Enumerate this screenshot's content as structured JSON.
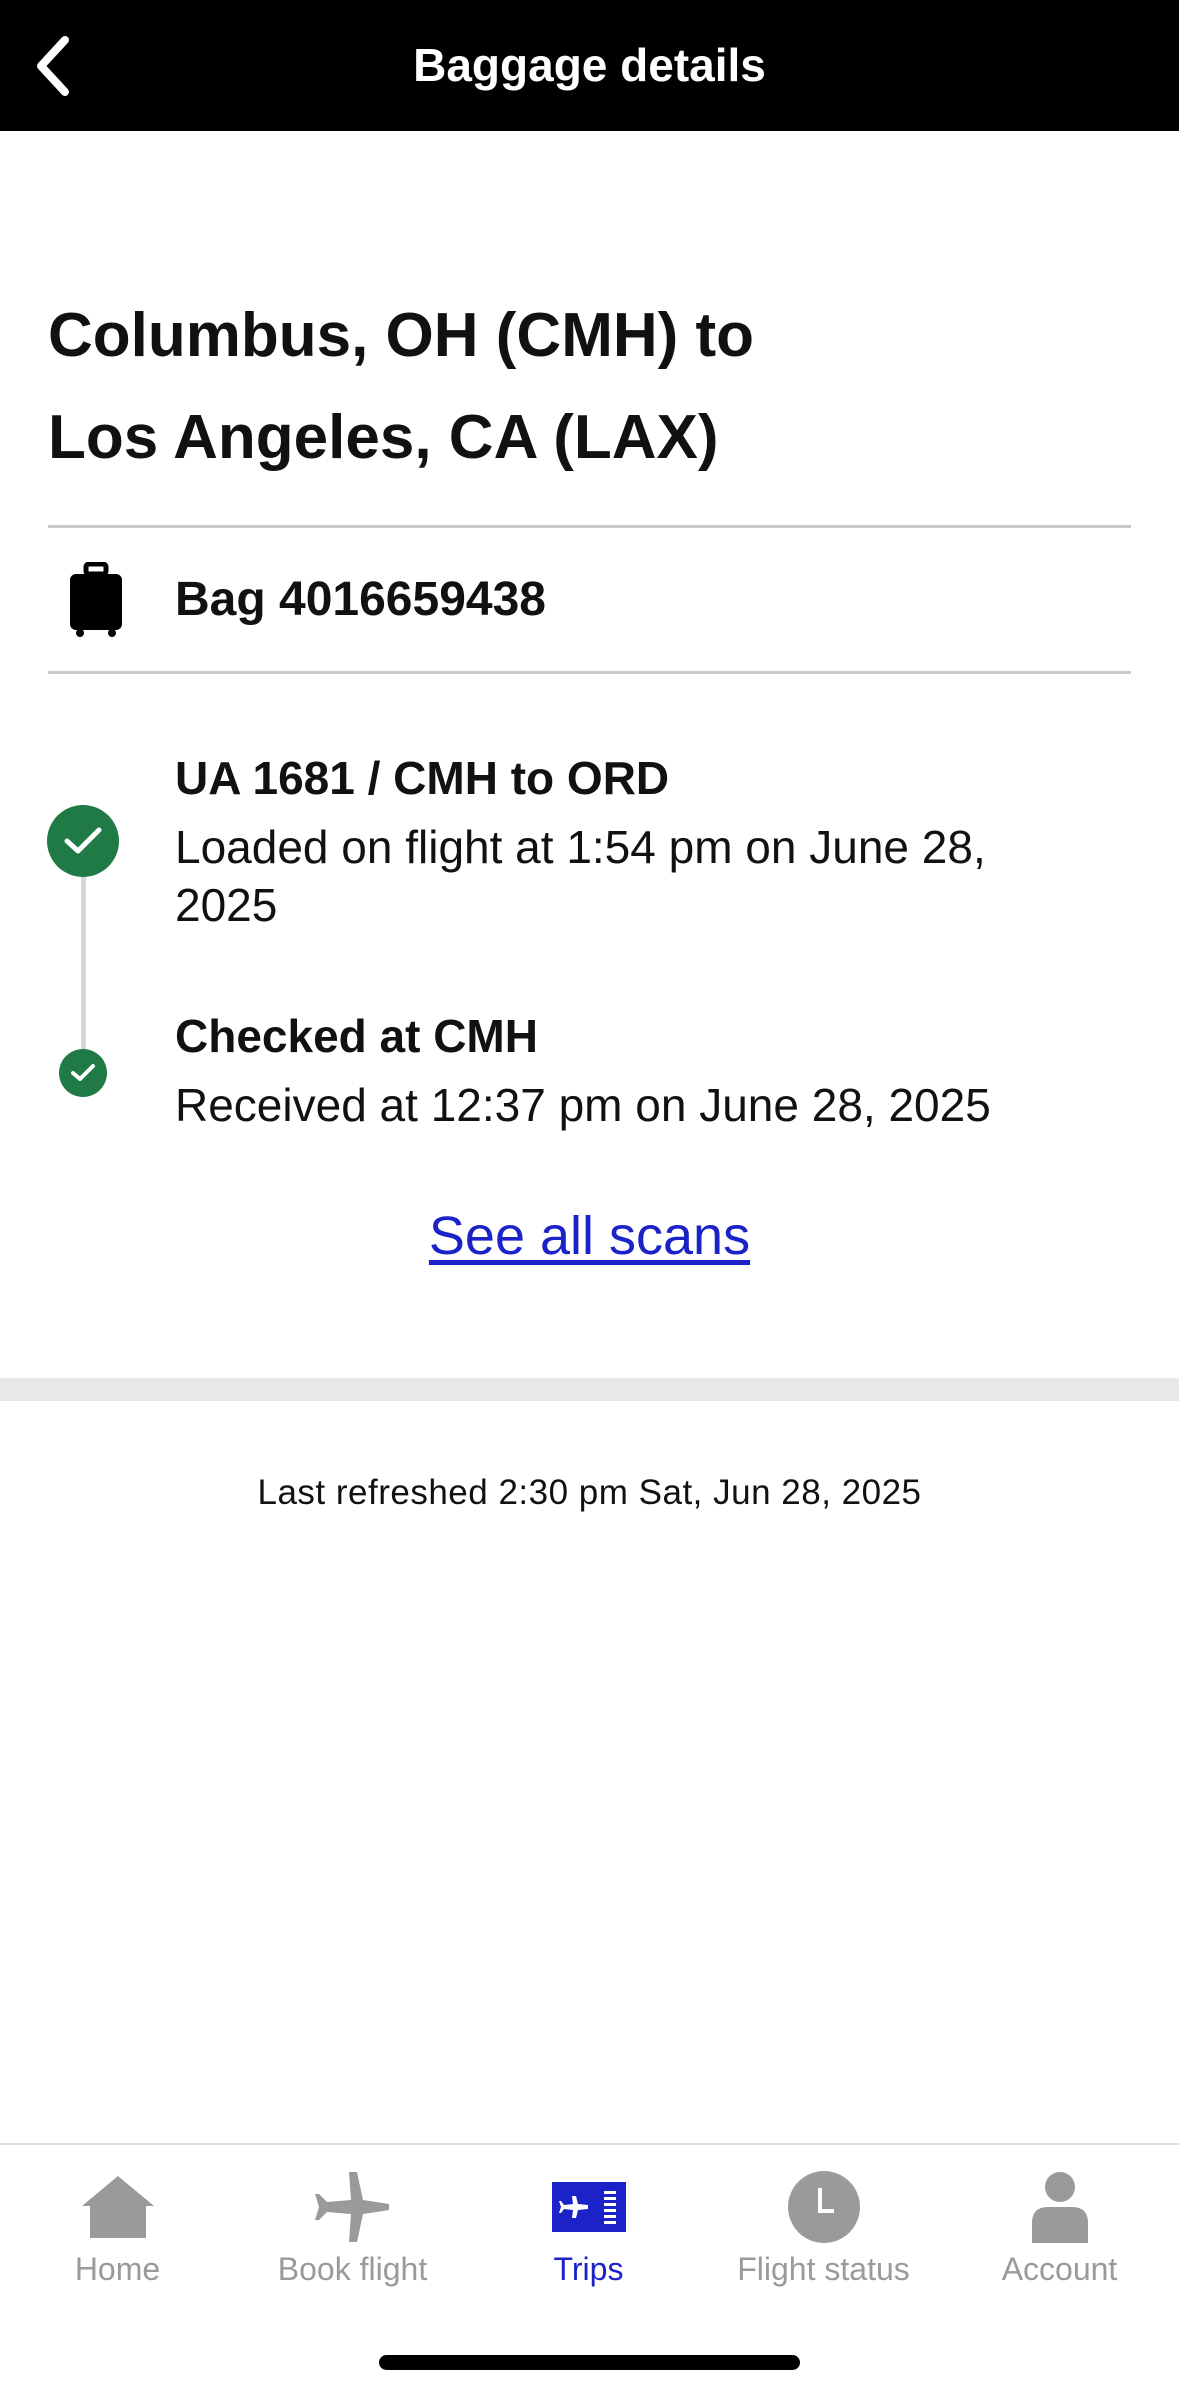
{
  "header": {
    "title": "Baggage details",
    "back_icon": "chevron-left-icon"
  },
  "route": {
    "line1": "Columbus, OH (CMH) to",
    "line2": "Los Angeles, CA (LAX)"
  },
  "bag": {
    "icon": "suitcase-icon",
    "label": "Bag 4016659438"
  },
  "timeline": [
    {
      "title": "UA 1681 / CMH to ORD",
      "detail": "Loaded on flight at 1:54 pm on June 28, 2025",
      "status": "complete"
    },
    {
      "title": "Checked at CMH",
      "detail": "Received at 12:37 pm on June 28, 2025",
      "status": "complete"
    }
  ],
  "see_all_label": "See all scans",
  "last_refreshed": "Last refreshed 2:30 pm Sat, Jun 28, 2025",
  "bottom_nav": [
    {
      "label": "Home",
      "icon": "home-icon",
      "active": false
    },
    {
      "label": "Book flight",
      "icon": "airplane-icon",
      "active": false
    },
    {
      "label": "Trips",
      "icon": "ticket-icon",
      "active": true
    },
    {
      "label": "Flight status",
      "icon": "clock-icon",
      "active": false
    },
    {
      "label": "Account",
      "icon": "person-icon",
      "active": false
    }
  ],
  "colors": {
    "header_bg": "#000000",
    "accent_blue": "#1a22c8",
    "success_green": "#1f7a46",
    "inactive_gray": "#9a9a9a"
  }
}
